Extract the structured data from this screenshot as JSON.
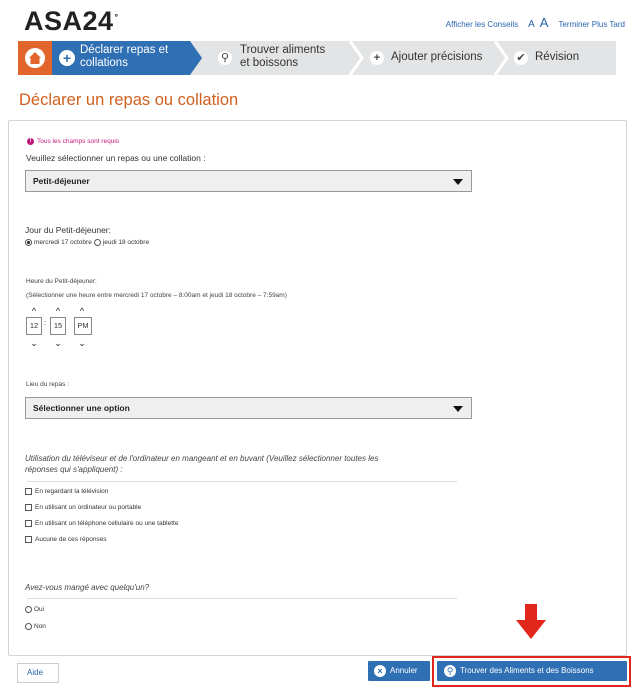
{
  "app": {
    "logo": "ASA24",
    "logo_mark": "°"
  },
  "toplinks": {
    "tips": "Afficher les Conseils",
    "font_small": "A",
    "font_large": "A",
    "finish_later": "Terminer Plus Tard"
  },
  "steps": [
    {
      "label_l1": "Déclarer repas et",
      "label_l2": "collations",
      "icon": "plus-icon",
      "active": true
    },
    {
      "label_l1": "Trouver aliments",
      "label_l2": "et boissons",
      "icon": "search-icon",
      "active": false
    },
    {
      "label": "Ajouter précisions",
      "icon": "plus-icon",
      "active": false
    },
    {
      "label": "Révision",
      "icon": "check-icon",
      "active": false
    }
  ],
  "page_title": "Déclarer un repas ou collation",
  "form": {
    "required_note": "Tous les champs sont requis",
    "meal_label": "Veuillez sélectionner un repas ou une collation :",
    "meal_value": "Petit-déjeuner",
    "day_label": "Jour du Petit-déjeuner:",
    "day_options": [
      "mercredi 17 octobre",
      "jeudi 18 octobre"
    ],
    "day_selected": 0,
    "time_label": "Heure du Petit-déjeuner:",
    "time_hint": "(Sélectionner une heure entre mercredi 17 octobre – 8:00am et jeudi 18 octobre – 7:59am)",
    "time": {
      "hour": "12",
      "minute": "15",
      "ampm": "PM",
      "separator": ":"
    },
    "location_label": "Lieu du repas :",
    "location_value": "Sélectionner une option",
    "screen_question_l1": "Utilisation du téléviseur et de l'ordinateur en mangeant et en buvant (Veuillez sélectionner toutes les",
    "screen_question_l2": "réponses qui s'appliquent) :",
    "screen_options": [
      "En regardant la télévision",
      "En utilisant un ordinateur ou portable",
      "En utilisant un téléphone cellulaire ou une tablette",
      "Aucune de ces réponses"
    ],
    "company_question": "Avez-vous mangé avec quelqu'un?",
    "company_options": [
      "Oui",
      "Non"
    ]
  },
  "footer": {
    "help": "Aide",
    "cancel": "Annuler",
    "find": "Trouver des Aliments et des Boissons"
  },
  "colors": {
    "brand_orange": "#e2662c",
    "primary_blue": "#2f6fb3",
    "highlight_red": "#e1261c",
    "required_magenta": "#c0187a"
  }
}
